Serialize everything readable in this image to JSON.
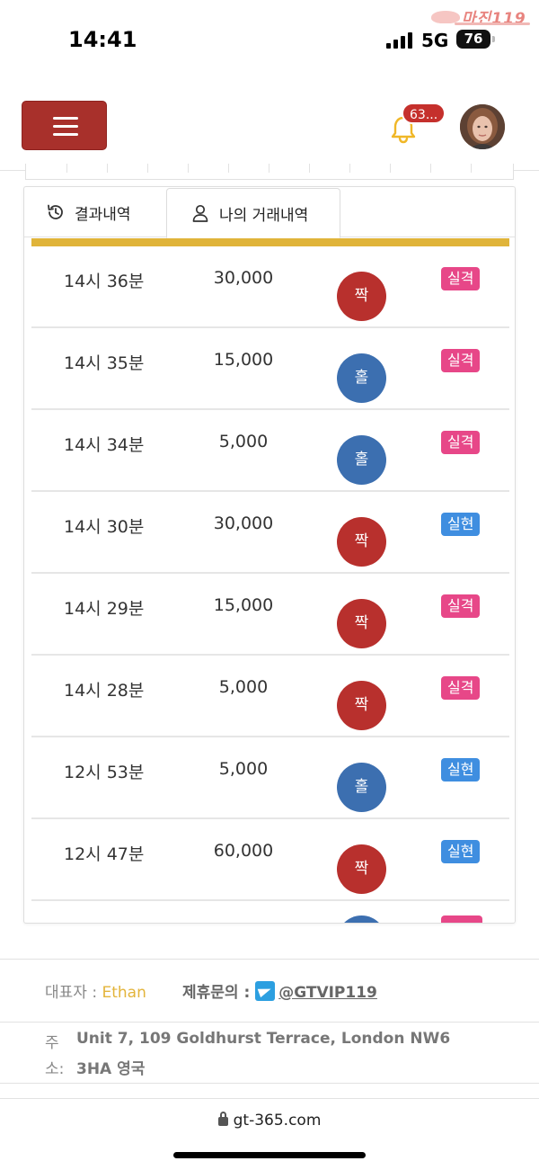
{
  "status_bar": {
    "time": "14:41",
    "network": "5G",
    "battery": "76",
    "watermark": "마진119"
  },
  "header": {
    "notification_count": "63...",
    "colors": {
      "menu_button": "#a8302b",
      "badge": "#c5302c",
      "bell": "#f0b727"
    }
  },
  "tabs": [
    {
      "label": "결과내역",
      "icon": "history-icon",
      "active": false
    },
    {
      "label": "나의 거래내역",
      "icon": "user-icon",
      "active": true
    }
  ],
  "rows": [
    {
      "time": "14시 36분",
      "amount": "30,000",
      "pick": "짝",
      "pick_color": "red",
      "result": "실격",
      "result_type": "lose"
    },
    {
      "time": "14시 35분",
      "amount": "15,000",
      "pick": "홀",
      "pick_color": "blue",
      "result": "실격",
      "result_type": "lose"
    },
    {
      "time": "14시 34분",
      "amount": "5,000",
      "pick": "홀",
      "pick_color": "blue",
      "result": "실격",
      "result_type": "lose"
    },
    {
      "time": "14시 30분",
      "amount": "30,000",
      "pick": "짝",
      "pick_color": "red",
      "result": "실현",
      "result_type": "win"
    },
    {
      "time": "14시 29분",
      "amount": "15,000",
      "pick": "짝",
      "pick_color": "red",
      "result": "실격",
      "result_type": "lose"
    },
    {
      "time": "14시 28분",
      "amount": "5,000",
      "pick": "짝",
      "pick_color": "red",
      "result": "실격",
      "result_type": "lose"
    },
    {
      "time": "12시 53분",
      "amount": "5,000",
      "pick": "홀",
      "pick_color": "blue",
      "result": "실현",
      "result_type": "win"
    },
    {
      "time": "12시 47분",
      "amount": "60,000",
      "pick": "짝",
      "pick_color": "red",
      "result": "실현",
      "result_type": "win"
    }
  ],
  "footer": {
    "rep_label": "대표자 :",
    "rep_name": "Ethan",
    "partner_label": "제휴문의 :",
    "partner_handle": "@GTVIP119",
    "address_label_1": "주",
    "address_label_2": "소:",
    "address_line_1": "Unit 7, 109 Goldhurst Terrace, London NW6",
    "address_line_2": "3HA 영국"
  },
  "browser": {
    "url": "gt-365.com"
  }
}
